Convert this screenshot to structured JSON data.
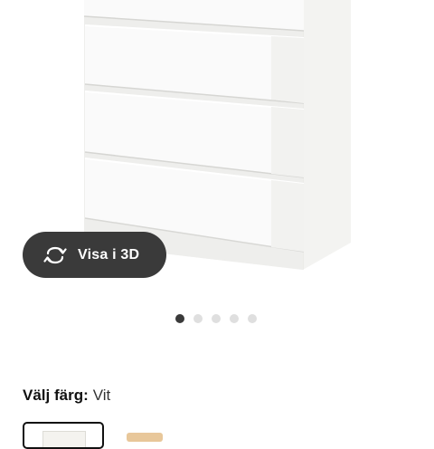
{
  "gallery": {
    "view3d_label": "Visa i 3D",
    "view3d_icon": "rotate-3d-icon",
    "total_images": 5,
    "active_image_index": 0
  },
  "color": {
    "label": "Välj färg:",
    "value": "Vit",
    "swatches": [
      {
        "name": "Vit",
        "color": "#ffffff",
        "selected": true
      },
      {
        "name": "oak",
        "color": "#e8c79a",
        "selected": false
      }
    ]
  },
  "colors": {
    "button_bg": "#3a3a3a",
    "dot_inactive": "#dfdfdf",
    "dot_active": "#3a3a3a"
  }
}
